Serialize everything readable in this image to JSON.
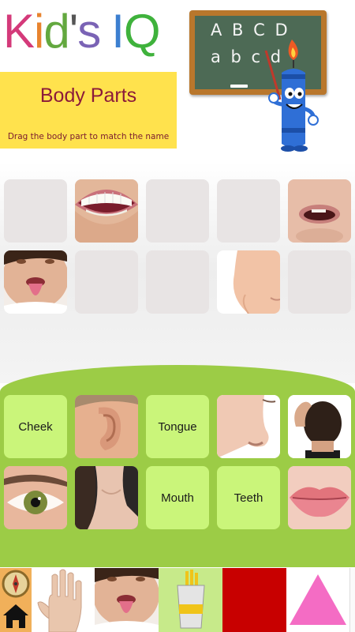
{
  "logo": {
    "letters": [
      "K",
      "i",
      "d",
      "'",
      "s",
      " ",
      "I",
      "Q"
    ],
    "colors": [
      "#d43a7a",
      "#e8832e",
      "#63a83f",
      "#555555",
      "#7a63b5",
      "#ffffff",
      "#3c7fd0",
      "#3fb23c"
    ]
  },
  "title_box": {
    "title": "Body Parts",
    "instructions": "Drag the body part to match the name"
  },
  "chalkboard": {
    "line1": "A B C D",
    "line2": "a b c d"
  },
  "drop_slots": [
    {
      "id": "slot-1",
      "filled_with": ""
    },
    {
      "id": "slot-2",
      "filled_with": "teeth"
    },
    {
      "id": "slot-3",
      "filled_with": ""
    },
    {
      "id": "slot-4",
      "filled_with": ""
    },
    {
      "id": "slot-5",
      "filled_with": "mouth"
    },
    {
      "id": "slot-6",
      "filled_with": "tongue"
    },
    {
      "id": "slot-7",
      "filled_with": ""
    },
    {
      "id": "slot-8",
      "filled_with": ""
    },
    {
      "id": "slot-9",
      "filled_with": "cheek"
    },
    {
      "id": "slot-10",
      "filled_with": ""
    }
  ],
  "name_labels": [
    "Cheek",
    "Tongue",
    "Mouth",
    "Teeth"
  ],
  "draggable_photos": [
    "ear",
    "nose",
    "hair",
    "eye",
    "neck",
    "lips"
  ],
  "bottom_bar": {
    "items": [
      "home-compass",
      "hand",
      "tongue",
      "paint-cup",
      "red-square",
      "pink-triangle",
      "white"
    ]
  },
  "colors": {
    "green_area": "#9ccc46",
    "label_tile": "#caf57a",
    "title_box": "#ffe24d",
    "title_text": "#8b1a3a"
  }
}
